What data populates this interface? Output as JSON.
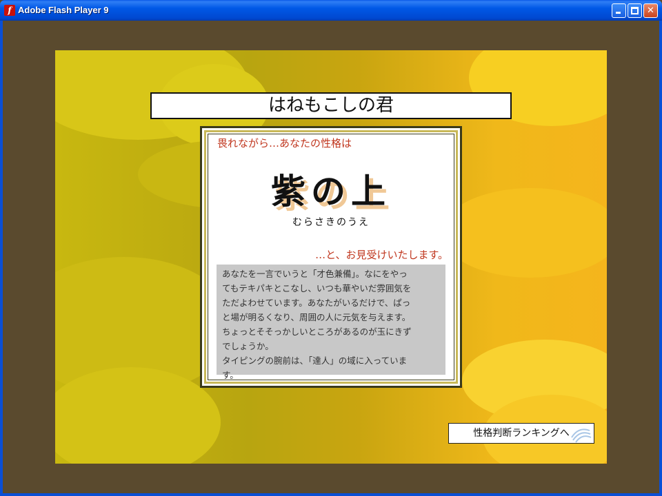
{
  "window": {
    "title": "Adobe Flash Player 9",
    "icon": "flash-player-icon",
    "controls": [
      "minimize-icon",
      "maximize-icon",
      "close-icon"
    ]
  },
  "result": {
    "player_title": "はねもこしの君",
    "intro": "畏れながら…あなたの性格は",
    "character_name": "紫の上",
    "character_reading": "むらさきのうえ",
    "verdict": "…と、お見受けいたします。",
    "description_lines": [
      "あなたを一言でいうと「才色兼備」。なにをやっ",
      "てもテキパキとこなし、いつも華やいだ雰囲気を",
      "ただよわせています。あなたがいるだけで、ぱっ",
      "と場が明るくなり、周囲の人に元気を与えます。",
      "ちょっとそそっかしいところがあるのが玉にきず",
      "でしょうか。",
      "タイピングの腕前は、「達人」の域に入っていま",
      "す。"
    ]
  },
  "ranking_button": {
    "label": "性格判断ランキングへ"
  },
  "colors": {
    "accent_red": "#c0361e",
    "frame_blue": "#0a4fd6",
    "outer_bg": "#5a4a2e",
    "desc_bg": "#c8c8c8"
  }
}
